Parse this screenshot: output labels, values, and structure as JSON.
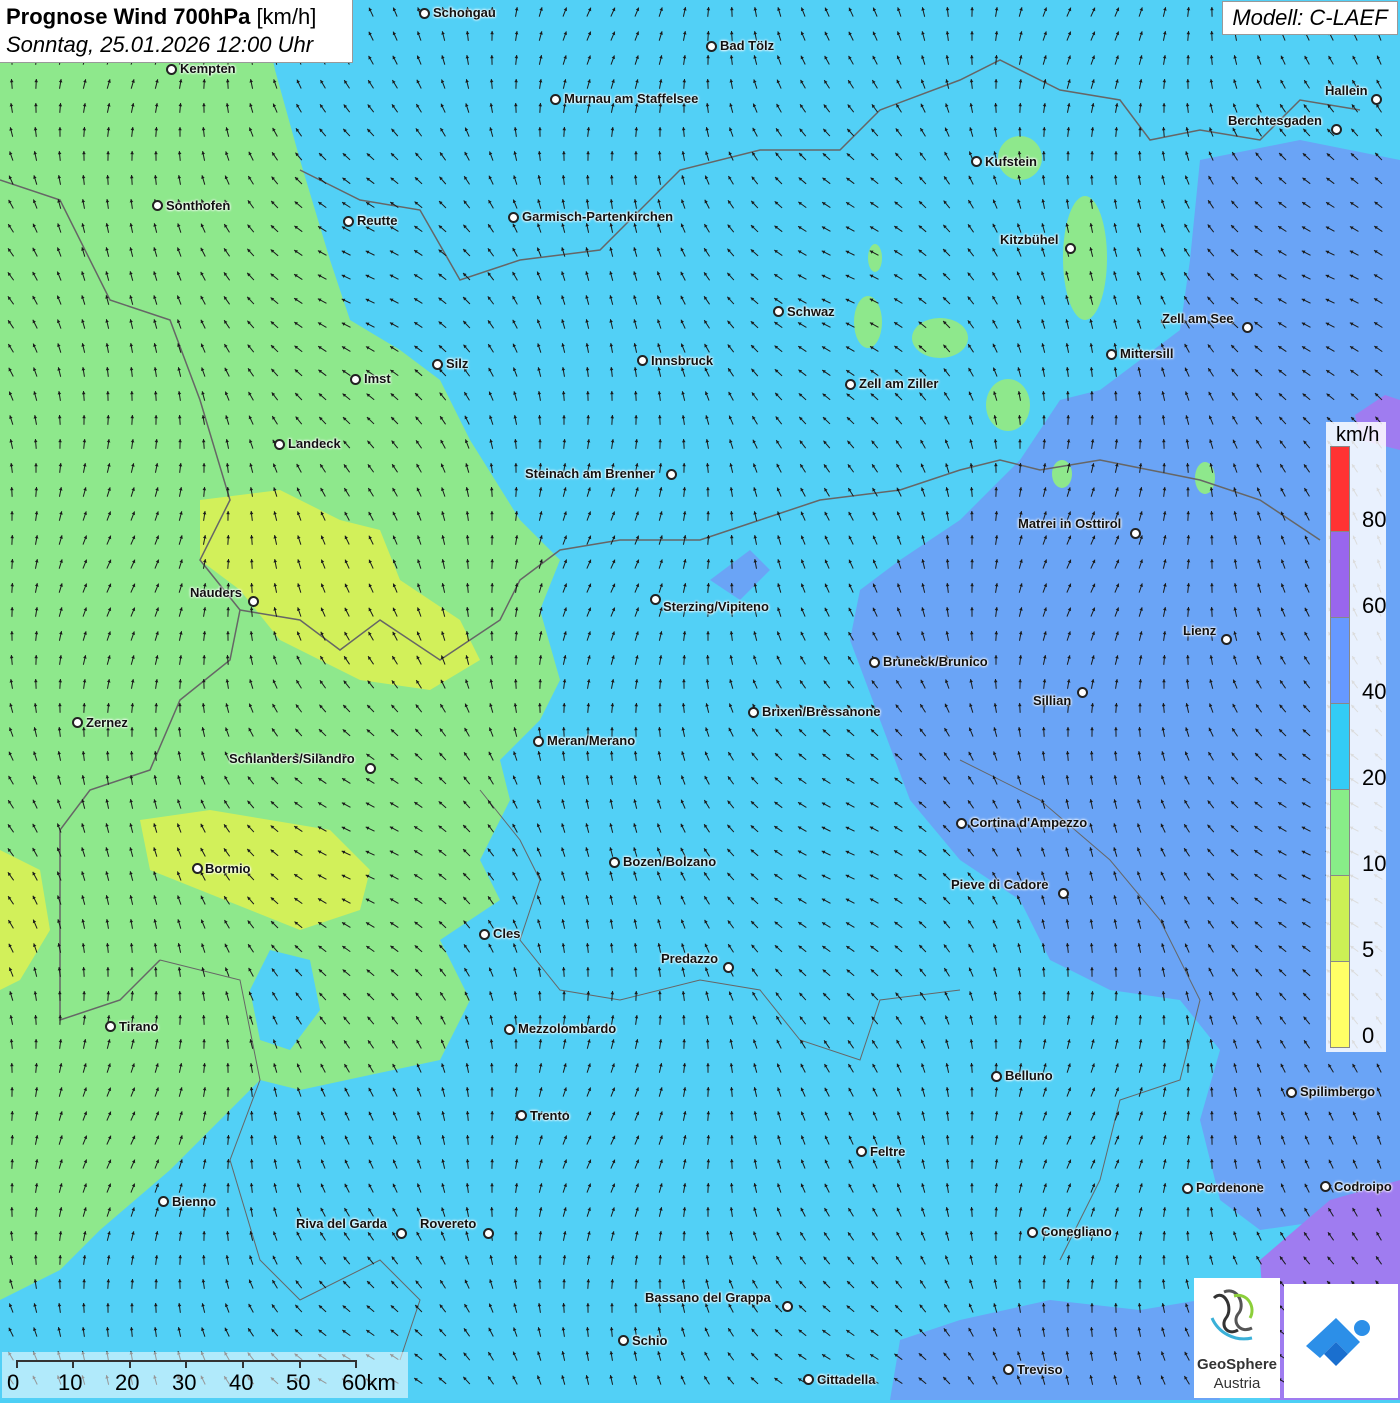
{
  "header": {
    "title_bold": "Prognose Wind 700hPa",
    "title_unit": "[km/h]",
    "subtitle": "Sonntag, 25.01.2026 12:00 Uhr"
  },
  "model_label": "Modell: C-LAEF",
  "legend": {
    "unit": "km/h",
    "ticks": [
      "80",
      "60",
      "40",
      "20",
      "10",
      "5",
      "0"
    ],
    "colors": [
      "#ff3333",
      "#9966ee",
      "#6699ff",
      "#33ccf5",
      "#88ee88",
      "#ccf055",
      "#ffff66"
    ]
  },
  "scalebar": {
    "labels": [
      "0",
      "10",
      "20",
      "30",
      "40",
      "50",
      "60km"
    ]
  },
  "logo": {
    "name": "GeoSphere",
    "subname": "Austria"
  },
  "colors": {
    "zone_green": "#8ee88c",
    "zone_cyan": "#52d0f6",
    "zone_blue": "#6aa4f6",
    "zone_yellow": "#d2f05a",
    "zone_purple": "#9f7cf0"
  },
  "cities": [
    {
      "name": "Schongau"
    },
    {
      "name": "Bad Tölz"
    },
    {
      "name": "Kempten"
    },
    {
      "name": "Murnau am Staffelsee"
    },
    {
      "name": "Hallein"
    },
    {
      "name": "Berchtesgaden"
    },
    {
      "name": "Kufstein"
    },
    {
      "name": "Sonthofen"
    },
    {
      "name": "Reutte"
    },
    {
      "name": "Garmisch-Partenkirchen"
    },
    {
      "name": "Kitzbühel"
    },
    {
      "name": "Schwaz"
    },
    {
      "name": "Zell am See"
    },
    {
      "name": "Mittersill"
    },
    {
      "name": "Silz"
    },
    {
      "name": "Innsbruck"
    },
    {
      "name": "Imst"
    },
    {
      "name": "Zell am Ziller"
    },
    {
      "name": "Landeck"
    },
    {
      "name": "Steinach am Brenner"
    },
    {
      "name": "Matrei in Osttirol"
    },
    {
      "name": "Nauders"
    },
    {
      "name": "Sterzing/Vipiteno"
    },
    {
      "name": "Lienz"
    },
    {
      "name": "Bruneck/Brunico"
    },
    {
      "name": "Sillian"
    },
    {
      "name": "Zernez"
    },
    {
      "name": "Brixen/Bressanone"
    },
    {
      "name": "Meran/Merano"
    },
    {
      "name": "Schlanders/Silandro"
    },
    {
      "name": "Cortina d'Ampezzo"
    },
    {
      "name": "Bozen/Bolzano"
    },
    {
      "name": "Bormio"
    },
    {
      "name": "Pieve di Cadore"
    },
    {
      "name": "Cles"
    },
    {
      "name": "Predazzo"
    },
    {
      "name": "Tirano"
    },
    {
      "name": "Mezzolombardo"
    },
    {
      "name": "Belluno"
    },
    {
      "name": "Spilimbergo"
    },
    {
      "name": "Trento"
    },
    {
      "name": "Feltre"
    },
    {
      "name": "Pordenone"
    },
    {
      "name": "Codroipo"
    },
    {
      "name": "Bienno"
    },
    {
      "name": "Riva del Garda"
    },
    {
      "name": "Rovereto"
    },
    {
      "name": "Conegliano"
    },
    {
      "name": "Bassano del Grappa"
    },
    {
      "name": "Schio"
    },
    {
      "name": "Treviso"
    },
    {
      "name": "Cittadella"
    }
  ]
}
